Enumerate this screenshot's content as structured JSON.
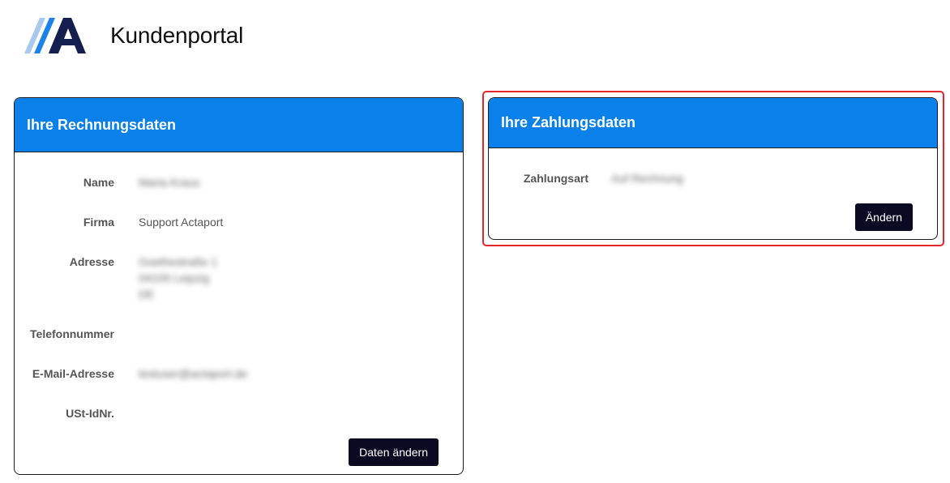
{
  "header": {
    "logo_icon": "actaport-logo-icon",
    "title": "Kundenportal"
  },
  "colors": {
    "card_header": "#0a80ea",
    "button": "#0a0a23",
    "highlight": "#e8242d",
    "logo_light": "#a9c8ee",
    "logo_mid": "#1a82e8",
    "logo_dark": "#141f4f"
  },
  "billing": {
    "title": "Ihre Rechnungsdaten",
    "rows": [
      {
        "label": "Name",
        "value": "Maria Kraus",
        "blurred": true
      },
      {
        "label": "Firma",
        "value": "Support Actaport",
        "blurred": false
      },
      {
        "label": "Adresse",
        "lines": [
          "Goethestraße 1",
          "04109 Leipzig",
          "DE"
        ],
        "blurred": true
      },
      {
        "label": "Telefonnummer",
        "value": "",
        "blurred": false
      },
      {
        "label": "E-Mail-Adresse",
        "value": "testuser@actaport.de",
        "blurred": true
      },
      {
        "label": "USt-IdNr.",
        "value": "",
        "blurred": false
      }
    ],
    "button_label": "Daten ändern"
  },
  "payment": {
    "title": "Ihre Zahlungsdaten",
    "rows": [
      {
        "label": "Zahlungsart",
        "value": "Auf Rechnung",
        "blurred": true
      }
    ],
    "button_label": "Ändern"
  }
}
